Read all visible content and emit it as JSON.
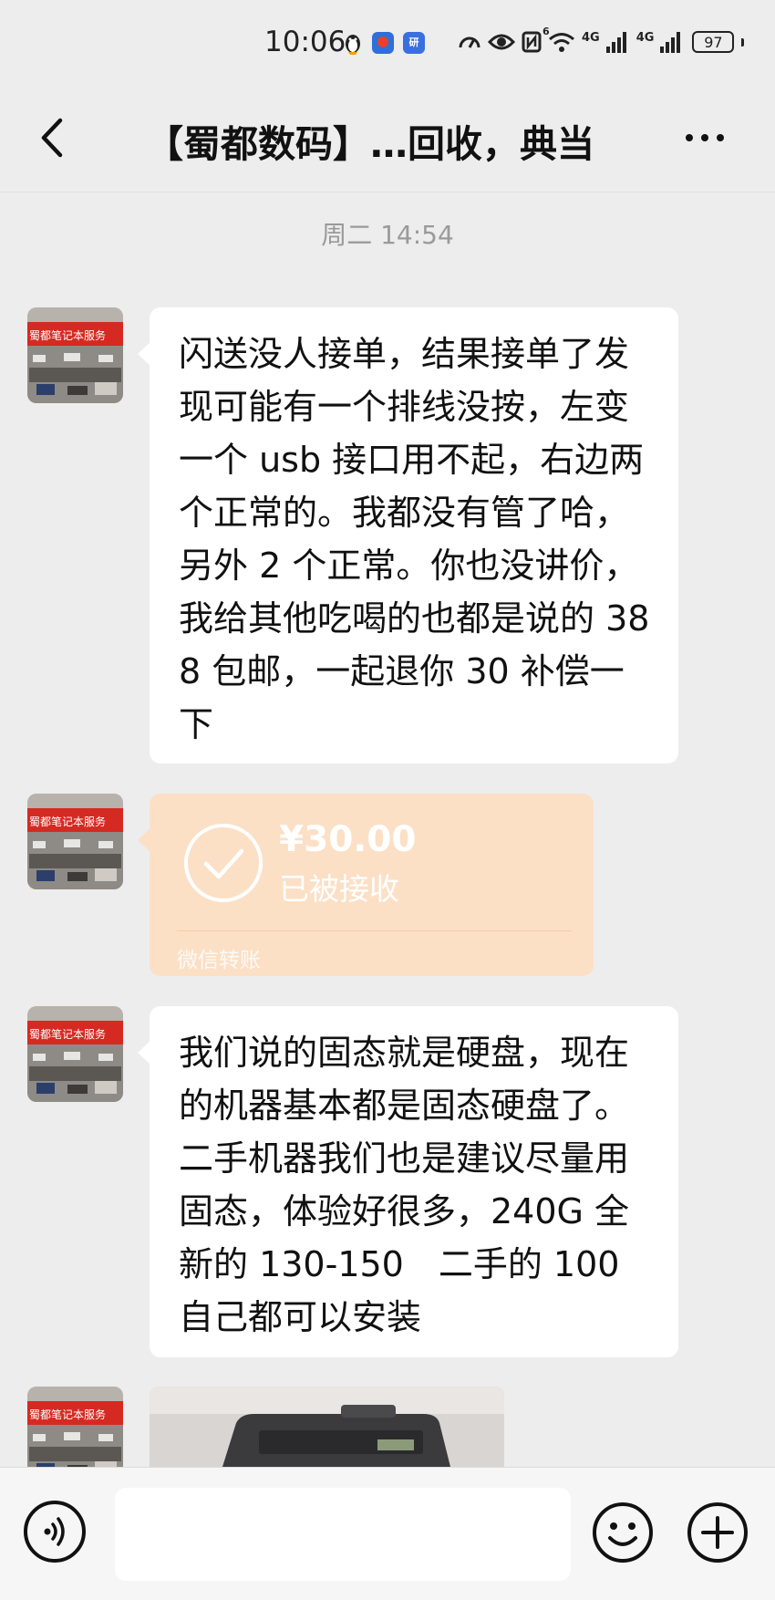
{
  "status_bar": {
    "time": "10:06",
    "net_1": "4G",
    "net_2": "4G",
    "wifi": "6",
    "battery": "97"
  },
  "header": {
    "title": "【蜀都数码】…回收，典当"
  },
  "chat": {
    "timestamp": "周二 14:54",
    "messages": [
      {
        "type": "text",
        "text": "闪送没人接单，结果接单了发现可能有一个排线没按，左变一个 usb 接口用不起，右边两个正常的。我都没有管了哈，另外 2 个正常。你也没讲价，我给其他吃喝的也都是说的 388 包邮，一起退你 30 补偿一下"
      },
      {
        "type": "transfer",
        "amount": "¥30.00",
        "status": "已被接收",
        "source": "微信转账"
      },
      {
        "type": "text",
        "text": "我们说的固态就是硬盘，现在的机器基本都是固态硬盘了。二手机器我们也是建议尽量用固态，体验好很多，240G 全新的 130-150　二手的 100　自己都可以安装"
      },
      {
        "type": "image"
      }
    ],
    "avatar_banner_text": "蜀都笔记本服务"
  },
  "colors": {
    "background": "#ededed",
    "bubble": "#ffffff",
    "transfer_card": "#fbe0c6",
    "input_bar": "#f6f6f6"
  },
  "icons": {
    "back": "chevron-left-icon",
    "more": "ellipsis-icon",
    "voice": "voice-icon",
    "emoji": "smiley-icon",
    "plus": "plus-icon",
    "accepted": "check-circle-icon"
  }
}
